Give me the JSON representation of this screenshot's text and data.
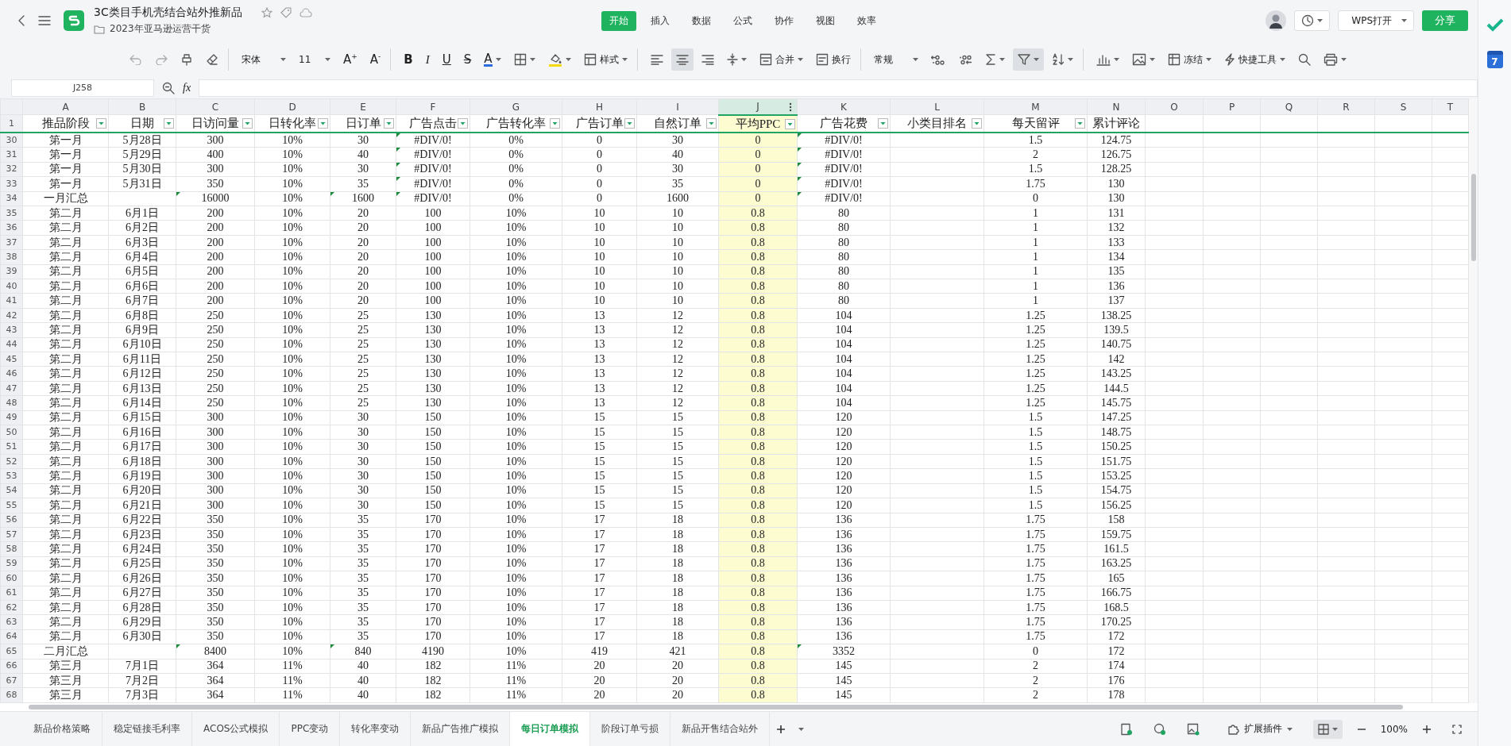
{
  "document": {
    "title": "3C类目手机壳结合站外推新品",
    "folder": "2023年亚马逊运营干货"
  },
  "menu_tabs": [
    {
      "label": "开始",
      "selected": true
    },
    {
      "label": "插入",
      "selected": false
    },
    {
      "label": "数据",
      "selected": false
    },
    {
      "label": "公式",
      "selected": false
    },
    {
      "label": "协作",
      "selected": false
    },
    {
      "label": "视图",
      "selected": false
    },
    {
      "label": "效率",
      "selected": false
    }
  ],
  "header_actions": {
    "open_button": "WPS打开",
    "share_button": "分享"
  },
  "toolbar": [
    {
      "kind": "icon",
      "disabled": true,
      "selected": false,
      "dropdown": false
    },
    {
      "kind": "icon",
      "disabled": true,
      "selected": false,
      "dropdown": false
    },
    {
      "kind": "icon",
      "disabled": false,
      "selected": false,
      "dropdown": false
    },
    {
      "kind": "icon",
      "disabled": false,
      "selected": false,
      "dropdown": false,
      "group_end": true
    },
    {
      "kind": "select",
      "label": "宋体",
      "disabled": false,
      "selected": false,
      "dropdown": true
    },
    {
      "kind": "select",
      "label": "11",
      "disabled": false,
      "selected": false,
      "dropdown": true
    },
    {
      "kind": "letter",
      "label": "A$^{+}$",
      "disabled": false,
      "selected": false,
      "dropdown": false
    },
    {
      "kind": "letter",
      "label": "A$^{-}$",
      "disabled": false,
      "selected": false,
      "dropdown": false,
      "group_end": true
    },
    {
      "kind": "letter",
      "label": "B",
      "disabled": false,
      "selected": false,
      "dropdown": false
    },
    {
      "kind": "letter",
      "label": "I",
      "disabled": false,
      "selected": false,
      "dropdown": false
    },
    {
      "kind": "letter",
      "label": "U",
      "disabled": false,
      "selected": false,
      "dropdown": false
    },
    {
      "kind": "letter",
      "label": "S",
      "disabled": false,
      "selected": false,
      "dropdown": false
    },
    {
      "kind": "letter",
      "label": "A",
      "disabled": false,
      "selected": false,
      "dropdown": true
    },
    {
      "kind": "icon",
      "disabled": false,
      "selected": false,
      "dropdown": true
    },
    {
      "kind": "icon",
      "disabled": false,
      "selected": false,
      "dropdown": true
    },
    {
      "kind": "labeled",
      "label": "样式",
      "disabled": false,
      "selected": false,
      "dropdown": true,
      "group_end": true
    },
    {
      "kind": "icon",
      "disabled": false,
      "selected": false,
      "dropdown": false
    },
    {
      "kind": "icon",
      "disabled": false,
      "selected": true,
      "dropdown": false
    },
    {
      "kind": "icon",
      "disabled": false,
      "selected": false,
      "dropdown": false
    },
    {
      "kind": "icon",
      "disabled": false,
      "selected": false,
      "dropdown": true
    },
    {
      "kind": "labeled",
      "label": "合并",
      "disabled": false,
      "selected": false,
      "dropdown": true
    },
    {
      "kind": "labeled",
      "label": "换行",
      "disabled": false,
      "selected": false,
      "dropdown": false,
      "group_end": true
    },
    {
      "kind": "select",
      "label": "常规",
      "disabled": false,
      "selected": false,
      "dropdown": true
    },
    {
      "kind": "icon",
      "disabled": false,
      "selected": false,
      "dropdown": false
    },
    {
      "kind": "icon",
      "disabled": false,
      "selected": false,
      "dropdown": false
    },
    {
      "kind": "icon",
      "disabled": false,
      "selected": false,
      "dropdown": true
    },
    {
      "kind": "icon",
      "disabled": false,
      "selected": true,
      "dropdown": true
    },
    {
      "kind": "icon",
      "disabled": false,
      "selected": false,
      "dropdown": true,
      "group_end": true
    },
    {
      "kind": "icon",
      "disabled": false,
      "selected": false,
      "dropdown": true
    },
    {
      "kind": "icon",
      "disabled": false,
      "selected": false,
      "dropdown": true
    },
    {
      "kind": "labeled",
      "label": "冻结",
      "disabled": false,
      "selected": false,
      "dropdown": true
    },
    {
      "kind": "labeled",
      "label": "快捷工具",
      "disabled": false,
      "selected": false,
      "dropdown": true
    },
    {
      "kind": "icon",
      "disabled": false,
      "selected": false,
      "dropdown": false
    },
    {
      "kind": "icon",
      "disabled": false,
      "selected": false,
      "dropdown": true
    }
  ],
  "formula_bar": {
    "cell_reference": "J258",
    "fx_label": "fx"
  },
  "columns": [
    {
      "letter": "A",
      "selected": false
    },
    {
      "letter": "B",
      "selected": false
    },
    {
      "letter": "C",
      "selected": false
    },
    {
      "letter": "D",
      "selected": false
    },
    {
      "letter": "E",
      "selected": false
    },
    {
      "letter": "F",
      "selected": false
    },
    {
      "letter": "G",
      "selected": false
    },
    {
      "letter": "H",
      "selected": false
    },
    {
      "letter": "I",
      "selected": false
    },
    {
      "letter": "J",
      "selected": true
    },
    {
      "letter": "K",
      "selected": false
    },
    {
      "letter": "L",
      "selected": false
    },
    {
      "letter": "M",
      "selected": false
    },
    {
      "letter": "N",
      "selected": false
    },
    {
      "letter": "O",
      "selected": false
    },
    {
      "letter": "P",
      "selected": false
    },
    {
      "letter": "Q",
      "selected": false
    },
    {
      "letter": "R",
      "selected": false
    },
    {
      "letter": "S",
      "selected": false
    },
    {
      "letter": "T",
      "selected": false
    }
  ],
  "header_row": {
    "n": "1",
    "cells": [
      {
        "text": "推品阶段",
        "filter": true
      },
      {
        "text": "日期",
        "filter": true
      },
      {
        "text": "日访问量",
        "filter": true
      },
      {
        "text": "日转化率",
        "filter": true
      },
      {
        "text": "日订单",
        "filter": true
      },
      {
        "text": "广告点击",
        "filter": true
      },
      {
        "text": "广告转化率",
        "filter": true
      },
      {
        "text": "广告订单",
        "filter": true
      },
      {
        "text": "自然订单",
        "filter": true
      },
      {
        "text": "平均PPC",
        "filter": true
      },
      {
        "text": "广告花费",
        "filter": true
      },
      {
        "text": "小类目排名",
        "filter": true
      },
      {
        "text": "每天留评",
        "filter": true
      },
      {
        "text": "累计评论",
        "filter": false
      }
    ]
  },
  "rows": [
    {
      "n": "30",
      "cells": [
        "第一月",
        "5月28日",
        "300",
        "10%",
        "30",
        {
          "text": "#DIV/0!",
          "flagged": true
        },
        "0%",
        "0",
        "30",
        "0",
        {
          "text": "#DIV/0!",
          "flagged": true
        },
        null,
        "1.5",
        "124.75"
      ]
    },
    {
      "n": "31",
      "cells": [
        "第一月",
        "5月29日",
        "400",
        "10%",
        "40",
        {
          "text": "#DIV/0!",
          "flagged": true
        },
        "0%",
        "0",
        "40",
        "0",
        {
          "text": "#DIV/0!",
          "flagged": true
        },
        null,
        "2",
        "126.75"
      ]
    },
    {
      "n": "32",
      "cells": [
        "第一月",
        "5月30日",
        "300",
        "10%",
        "30",
        {
          "text": "#DIV/0!",
          "flagged": true
        },
        "0%",
        "0",
        "30",
        "0",
        {
          "text": "#DIV/0!",
          "flagged": true
        },
        null,
        "1.5",
        "128.25"
      ]
    },
    {
      "n": "33",
      "cells": [
        "第一月",
        "5月31日",
        "350",
        "10%",
        "35",
        {
          "text": "#DIV/0!",
          "flagged": true
        },
        "0%",
        "0",
        "35",
        "0",
        {
          "text": "#DIV/0!",
          "flagged": true
        },
        null,
        "1.75",
        "130"
      ]
    },
    {
      "n": "34",
      "cells": [
        "一月汇总",
        null,
        {
          "text": "16000",
          "flagged": true
        },
        "10%",
        {
          "text": "1600",
          "flagged": true
        },
        {
          "text": "#DIV/0!",
          "flagged": true
        },
        "0%",
        "0",
        "1600",
        "0",
        {
          "text": "#DIV/0!",
          "flagged": true
        },
        null,
        "0",
        "130"
      ]
    },
    {
      "n": "35",
      "cells": [
        "第二月",
        "6月1日",
        "200",
        "10%",
        "20",
        "100",
        "10%",
        "10",
        "10",
        "0.8",
        "80",
        null,
        "1",
        "131"
      ]
    },
    {
      "n": "36",
      "cells": [
        "第二月",
        "6月2日",
        "200",
        "10%",
        "20",
        "100",
        "10%",
        "10",
        "10",
        "0.8",
        "80",
        null,
        "1",
        "132"
      ]
    },
    {
      "n": "37",
      "cells": [
        "第二月",
        "6月3日",
        "200",
        "10%",
        "20",
        "100",
        "10%",
        "10",
        "10",
        "0.8",
        "80",
        null,
        "1",
        "133"
      ]
    },
    {
      "n": "38",
      "cells": [
        "第二月",
        "6月4日",
        "200",
        "10%",
        "20",
        "100",
        "10%",
        "10",
        "10",
        "0.8",
        "80",
        null,
        "1",
        "134"
      ]
    },
    {
      "n": "39",
      "cells": [
        "第二月",
        "6月5日",
        "200",
        "10%",
        "20",
        "100",
        "10%",
        "10",
        "10",
        "0.8",
        "80",
        null,
        "1",
        "135"
      ]
    },
    {
      "n": "40",
      "cells": [
        "第二月",
        "6月6日",
        "200",
        "10%",
        "20",
        "100",
        "10%",
        "10",
        "10",
        "0.8",
        "80",
        null,
        "1",
        "136"
      ]
    },
    {
      "n": "41",
      "cells": [
        "第二月",
        "6月7日",
        "200",
        "10%",
        "20",
        "100",
        "10%",
        "10",
        "10",
        "0.8",
        "80",
        null,
        "1",
        "137"
      ]
    },
    {
      "n": "42",
      "cells": [
        "第二月",
        "6月8日",
        "250",
        "10%",
        "25",
        "130",
        "10%",
        "13",
        "12",
        "0.8",
        "104",
        null,
        "1.25",
        "138.25"
      ]
    },
    {
      "n": "43",
      "cells": [
        "第二月",
        "6月9日",
        "250",
        "10%",
        "25",
        "130",
        "10%",
        "13",
        "12",
        "0.8",
        "104",
        null,
        "1.25",
        "139.5"
      ]
    },
    {
      "n": "44",
      "cells": [
        "第二月",
        "6月10日",
        "250",
        "10%",
        "25",
        "130",
        "10%",
        "13",
        "12",
        "0.8",
        "104",
        null,
        "1.25",
        "140.75"
      ]
    },
    {
      "n": "45",
      "cells": [
        "第二月",
        "6月11日",
        "250",
        "10%",
        "25",
        "130",
        "10%",
        "13",
        "12",
        "0.8",
        "104",
        null,
        "1.25",
        "142"
      ]
    },
    {
      "n": "46",
      "cells": [
        "第二月",
        "6月12日",
        "250",
        "10%",
        "25",
        "130",
        "10%",
        "13",
        "12",
        "0.8",
        "104",
        null,
        "1.25",
        "143.25"
      ]
    },
    {
      "n": "47",
      "cells": [
        "第二月",
        "6月13日",
        "250",
        "10%",
        "25",
        "130",
        "10%",
        "13",
        "12",
        "0.8",
        "104",
        null,
        "1.25",
        "144.5"
      ]
    },
    {
      "n": "48",
      "cells": [
        "第二月",
        "6月14日",
        "250",
        "10%",
        "25",
        "130",
        "10%",
        "13",
        "12",
        "0.8",
        "104",
        null,
        "1.25",
        "145.75"
      ]
    },
    {
      "n": "49",
      "cells": [
        "第二月",
        "6月15日",
        "300",
        "10%",
        "30",
        "150",
        "10%",
        "15",
        "15",
        "0.8",
        "120",
        null,
        "1.5",
        "147.25"
      ]
    },
    {
      "n": "50",
      "cells": [
        "第二月",
        "6月16日",
        "300",
        "10%",
        "30",
        "150",
        "10%",
        "15",
        "15",
        "0.8",
        "120",
        null,
        "1.5",
        "148.75"
      ]
    },
    {
      "n": "51",
      "cells": [
        "第二月",
        "6月17日",
        "300",
        "10%",
        "30",
        "150",
        "10%",
        "15",
        "15",
        "0.8",
        "120",
        null,
        "1.5",
        "150.25"
      ]
    },
    {
      "n": "52",
      "cells": [
        "第二月",
        "6月18日",
        "300",
        "10%",
        "30",
        "150",
        "10%",
        "15",
        "15",
        "0.8",
        "120",
        null,
        "1.5",
        "151.75"
      ]
    },
    {
      "n": "53",
      "cells": [
        "第二月",
        "6月19日",
        "300",
        "10%",
        "30",
        "150",
        "10%",
        "15",
        "15",
        "0.8",
        "120",
        null,
        "1.5",
        "153.25"
      ]
    },
    {
      "n": "54",
      "cells": [
        "第二月",
        "6月20日",
        "300",
        "10%",
        "30",
        "150",
        "10%",
        "15",
        "15",
        "0.8",
        "120",
        null,
        "1.5",
        "154.75"
      ]
    },
    {
      "n": "55",
      "cells": [
        "第二月",
        "6月21日",
        "300",
        "10%",
        "30",
        "150",
        "10%",
        "15",
        "15",
        "0.8",
        "120",
        null,
        "1.5",
        "156.25"
      ]
    },
    {
      "n": "56",
      "cells": [
        "第二月",
        "6月22日",
        "350",
        "10%",
        "35",
        "170",
        "10%",
        "17",
        "18",
        "0.8",
        "136",
        null,
        "1.75",
        "158"
      ]
    },
    {
      "n": "57",
      "cells": [
        "第二月",
        "6月23日",
        "350",
        "10%",
        "35",
        "170",
        "10%",
        "17",
        "18",
        "0.8",
        "136",
        null,
        "1.75",
        "159.75"
      ]
    },
    {
      "n": "58",
      "cells": [
        "第二月",
        "6月24日",
        "350",
        "10%",
        "35",
        "170",
        "10%",
        "17",
        "18",
        "0.8",
        "136",
        null,
        "1.75",
        "161.5"
      ]
    },
    {
      "n": "59",
      "cells": [
        "第二月",
        "6月25日",
        "350",
        "10%",
        "35",
        "170",
        "10%",
        "17",
        "18",
        "0.8",
        "136",
        null,
        "1.75",
        "163.25"
      ]
    },
    {
      "n": "60",
      "cells": [
        "第二月",
        "6月26日",
        "350",
        "10%",
        "35",
        "170",
        "10%",
        "17",
        "18",
        "0.8",
        "136",
        null,
        "1.75",
        "165"
      ]
    },
    {
      "n": "61",
      "cells": [
        "第二月",
        "6月27日",
        "350",
        "10%",
        "35",
        "170",
        "10%",
        "17",
        "18",
        "0.8",
        "136",
        null,
        "1.75",
        "166.75"
      ]
    },
    {
      "n": "62",
      "cells": [
        "第二月",
        "6月28日",
        "350",
        "10%",
        "35",
        "170",
        "10%",
        "17",
        "18",
        "0.8",
        "136",
        null,
        "1.75",
        "168.5"
      ]
    },
    {
      "n": "63",
      "cells": [
        "第二月",
        "6月29日",
        "350",
        "10%",
        "35",
        "170",
        "10%",
        "17",
        "18",
        "0.8",
        "136",
        null,
        "1.75",
        "170.25"
      ]
    },
    {
      "n": "64",
      "cells": [
        "第二月",
        "6月30日",
        "350",
        "10%",
        "35",
        "170",
        "10%",
        "17",
        "18",
        "0.8",
        "136",
        null,
        "1.75",
        "172"
      ]
    },
    {
      "n": "65",
      "cells": [
        "二月汇总",
        null,
        {
          "text": "8400",
          "flagged": true
        },
        "10%",
        {
          "text": "840",
          "flagged": true
        },
        "4190",
        "10%",
        "419",
        "421",
        "0.8",
        {
          "text": "3352",
          "flagged": true
        },
        null,
        "0",
        "172"
      ]
    },
    {
      "n": "66",
      "cells": [
        "第三月",
        "7月1日",
        "364",
        "11%",
        "40",
        "182",
        "11%",
        "20",
        "20",
        "0.8",
        "145",
        null,
        "2",
        "174"
      ]
    },
    {
      "n": "67",
      "cells": [
        "第三月",
        "7月2日",
        "364",
        "11%",
        "40",
        "182",
        "11%",
        "20",
        "20",
        "0.8",
        "145",
        null,
        "2",
        "176"
      ]
    },
    {
      "n": "68",
      "cells": [
        "第三月",
        "7月3日",
        "364",
        "11%",
        "40",
        "182",
        "11%",
        "20",
        "20",
        "0.8",
        "145",
        null,
        "2",
        "178"
      ]
    }
  ],
  "sheet_tabs": [
    {
      "label": "新品价格策略",
      "selected": false
    },
    {
      "label": "稳定链接毛利率",
      "selected": false
    },
    {
      "label": "ACOS公式模拟",
      "selected": false
    },
    {
      "label": "PPC变动",
      "selected": false
    },
    {
      "label": "转化率变动",
      "selected": false
    },
    {
      "label": "新品广告推广模拟",
      "selected": false
    },
    {
      "label": "每日订单模拟",
      "selected": true
    },
    {
      "label": "阶段订单亏损",
      "selected": false
    },
    {
      "label": "新品开售结合站外",
      "selected": false
    }
  ],
  "status_bar": {
    "plugins_button": "扩展插件",
    "zoom": "100%"
  },
  "side_panel": {
    "calendar_day": "7"
  }
}
